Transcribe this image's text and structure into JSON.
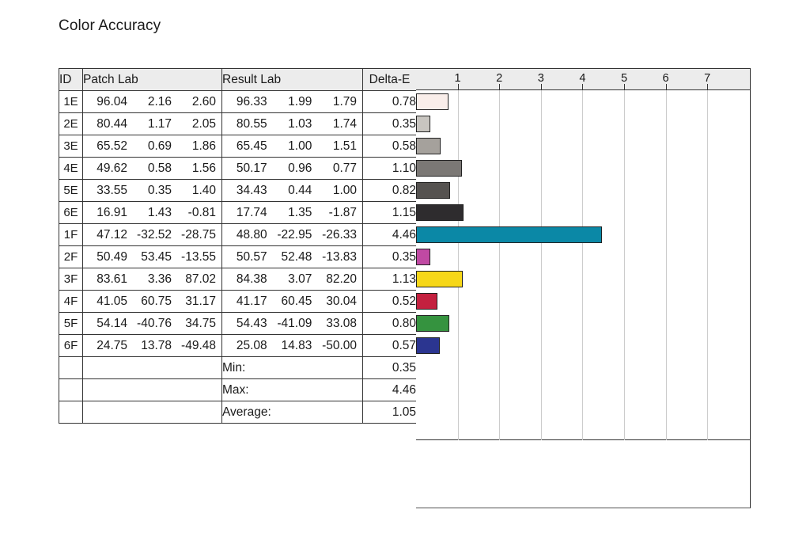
{
  "title": "Color Accuracy",
  "table": {
    "headers": {
      "id": "ID",
      "patch": "Patch Lab",
      "result": "Result Lab",
      "delta_e": "Delta-E"
    },
    "rows": [
      {
        "id": "1E",
        "patch": [
          "96.04",
          "2.16",
          "2.60"
        ],
        "result": [
          "96.33",
          "1.99",
          "1.79"
        ],
        "delta_e": "0.78",
        "color": "#f9eeea"
      },
      {
        "id": "2E",
        "patch": [
          "80.44",
          "1.17",
          "2.05"
        ],
        "result": [
          "80.55",
          "1.03",
          "1.74"
        ],
        "delta_e": "0.35",
        "color": "#c8c5c0"
      },
      {
        "id": "3E",
        "patch": [
          "65.52",
          "0.69",
          "1.86"
        ],
        "result": [
          "65.45",
          "1.00",
          "1.51"
        ],
        "delta_e": "0.58",
        "color": "#a5a19c"
      },
      {
        "id": "4E",
        "patch": [
          "49.62",
          "0.58",
          "1.56"
        ],
        "result": [
          "50.17",
          "0.96",
          "0.77"
        ],
        "delta_e": "1.10",
        "color": "#7b7875"
      },
      {
        "id": "5E",
        "patch": [
          "33.55",
          "0.35",
          "1.40"
        ],
        "result": [
          "34.43",
          "0.44",
          "1.00"
        ],
        "delta_e": "0.82",
        "color": "#555250"
      },
      {
        "id": "6E",
        "patch": [
          "16.91",
          "1.43",
          "-0.81"
        ],
        "result": [
          "17.74",
          "1.35",
          "-1.87"
        ],
        "delta_e": "1.15",
        "color": "#2e2c2e"
      },
      {
        "id": "1F",
        "patch": [
          "47.12",
          "-32.52",
          "-28.75"
        ],
        "result": [
          "48.80",
          "-22.95",
          "-26.33"
        ],
        "delta_e": "4.46",
        "color": "#0b88a6"
      },
      {
        "id": "2F",
        "patch": [
          "50.49",
          "53.45",
          "-13.55"
        ],
        "result": [
          "50.57",
          "52.48",
          "-13.83"
        ],
        "delta_e": "0.35",
        "color": "#c049a3"
      },
      {
        "id": "3F",
        "patch": [
          "83.61",
          "3.36",
          "87.02"
        ],
        "result": [
          "84.38",
          "3.07",
          "82.20"
        ],
        "delta_e": "1.13",
        "color": "#f6d718"
      },
      {
        "id": "4F",
        "patch": [
          "41.05",
          "60.75",
          "31.17"
        ],
        "result": [
          "41.17",
          "60.45",
          "30.04"
        ],
        "delta_e": "0.52",
        "color": "#c4203f"
      },
      {
        "id": "5F",
        "patch": [
          "54.14",
          "-40.76",
          "34.75"
        ],
        "result": [
          "54.43",
          "-41.09",
          "33.08"
        ],
        "delta_e": "0.80",
        "color": "#35933f"
      },
      {
        "id": "6F",
        "patch": [
          "24.75",
          "13.78",
          "-49.48"
        ],
        "result": [
          "25.08",
          "14.83",
          "-50.00"
        ],
        "delta_e": "0.57",
        "color": "#2b3590"
      }
    ],
    "summary": [
      {
        "label": "Min:",
        "value": "0.35"
      },
      {
        "label": "Max:",
        "value": "4.46"
      },
      {
        "label": "Average:",
        "value": "1.05"
      }
    ]
  },
  "chart_data": {
    "type": "bar",
    "title": "Color Accuracy",
    "orientation": "horizontal",
    "xlabel": "",
    "ylabel": "",
    "xlim": [
      0,
      8
    ],
    "grid": true,
    "legend": false,
    "tick_labels": [
      "1",
      "2",
      "3",
      "4",
      "5",
      "6",
      "7"
    ],
    "ticks": [
      1,
      2,
      3,
      4,
      5,
      6,
      7
    ],
    "categories": [
      "1E",
      "2E",
      "3E",
      "4E",
      "5E",
      "6E",
      "1F",
      "2F",
      "3F",
      "4F",
      "5F",
      "6F"
    ],
    "values": [
      0.78,
      0.35,
      0.58,
      1.1,
      0.82,
      1.15,
      4.46,
      0.35,
      1.13,
      0.52,
      0.8,
      0.57
    ],
    "bar_colors": [
      "#f9eeea",
      "#c8c5c0",
      "#a5a19c",
      "#7b7875",
      "#555250",
      "#2e2c2e",
      "#0b88a6",
      "#c049a3",
      "#f6d718",
      "#c4203f",
      "#35933f",
      "#2b3590"
    ],
    "series": [
      {
        "name": "Delta-E",
        "values": [
          0.78,
          0.35,
          0.58,
          1.1,
          0.82,
          1.15,
          4.46,
          0.35,
          1.13,
          0.52,
          0.8,
          0.57
        ]
      }
    ],
    "stats": {
      "min": 0.35,
      "max": 4.46,
      "average": 1.05
    }
  }
}
